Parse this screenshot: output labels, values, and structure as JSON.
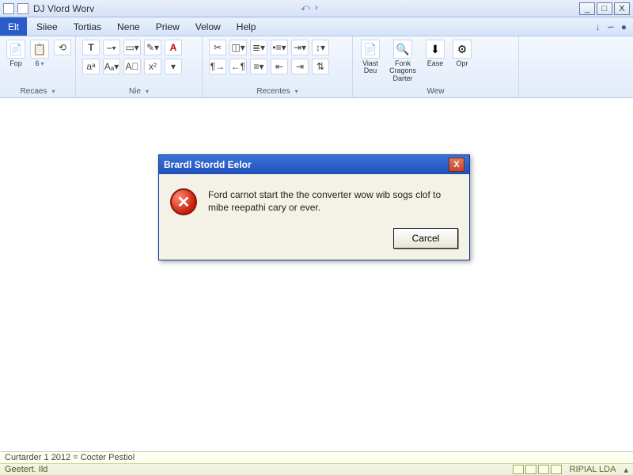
{
  "title": "DJ Vlord Worv",
  "qat": {
    "undo": "⤺",
    "redo": "›"
  },
  "win": {
    "min": "_",
    "max": "□",
    "close": "X"
  },
  "menu": {
    "file": "Elt",
    "items": [
      "Siiee",
      "Tortias",
      "Nene",
      "Priew",
      "Velow",
      "Help"
    ],
    "rightGlyphs": [
      "↓",
      "∽",
      "●"
    ]
  },
  "ribbon": {
    "g1": {
      "btn1": "Fop",
      "btn2": "6",
      "label": "Recaes"
    },
    "g2": {
      "label": "Nie"
    },
    "g3": {
      "label": "Recentes"
    },
    "g4": {
      "b1a": "Viast",
      "b1b": "Deu",
      "b2a": "Fonk",
      "b2b": "Cragons",
      "b2c": "Darter",
      "b3": "Ease",
      "b4": "Opr",
      "label": "Wew"
    }
  },
  "dialog": {
    "title": "Brardl Stordd Eelor",
    "message": "Ford carnot start the the converter wow wib sogs clof to mibe reepathi cary or ever.",
    "cancel": "Carcel",
    "closeGlyph": "X",
    "iconGlyph": "✕"
  },
  "status": {
    "line1": "Curtarder 1 2012 = Cocter Pestiol",
    "line2Left": "Geetert. Ild",
    "line2Right": "RIPIAL LDA"
  }
}
